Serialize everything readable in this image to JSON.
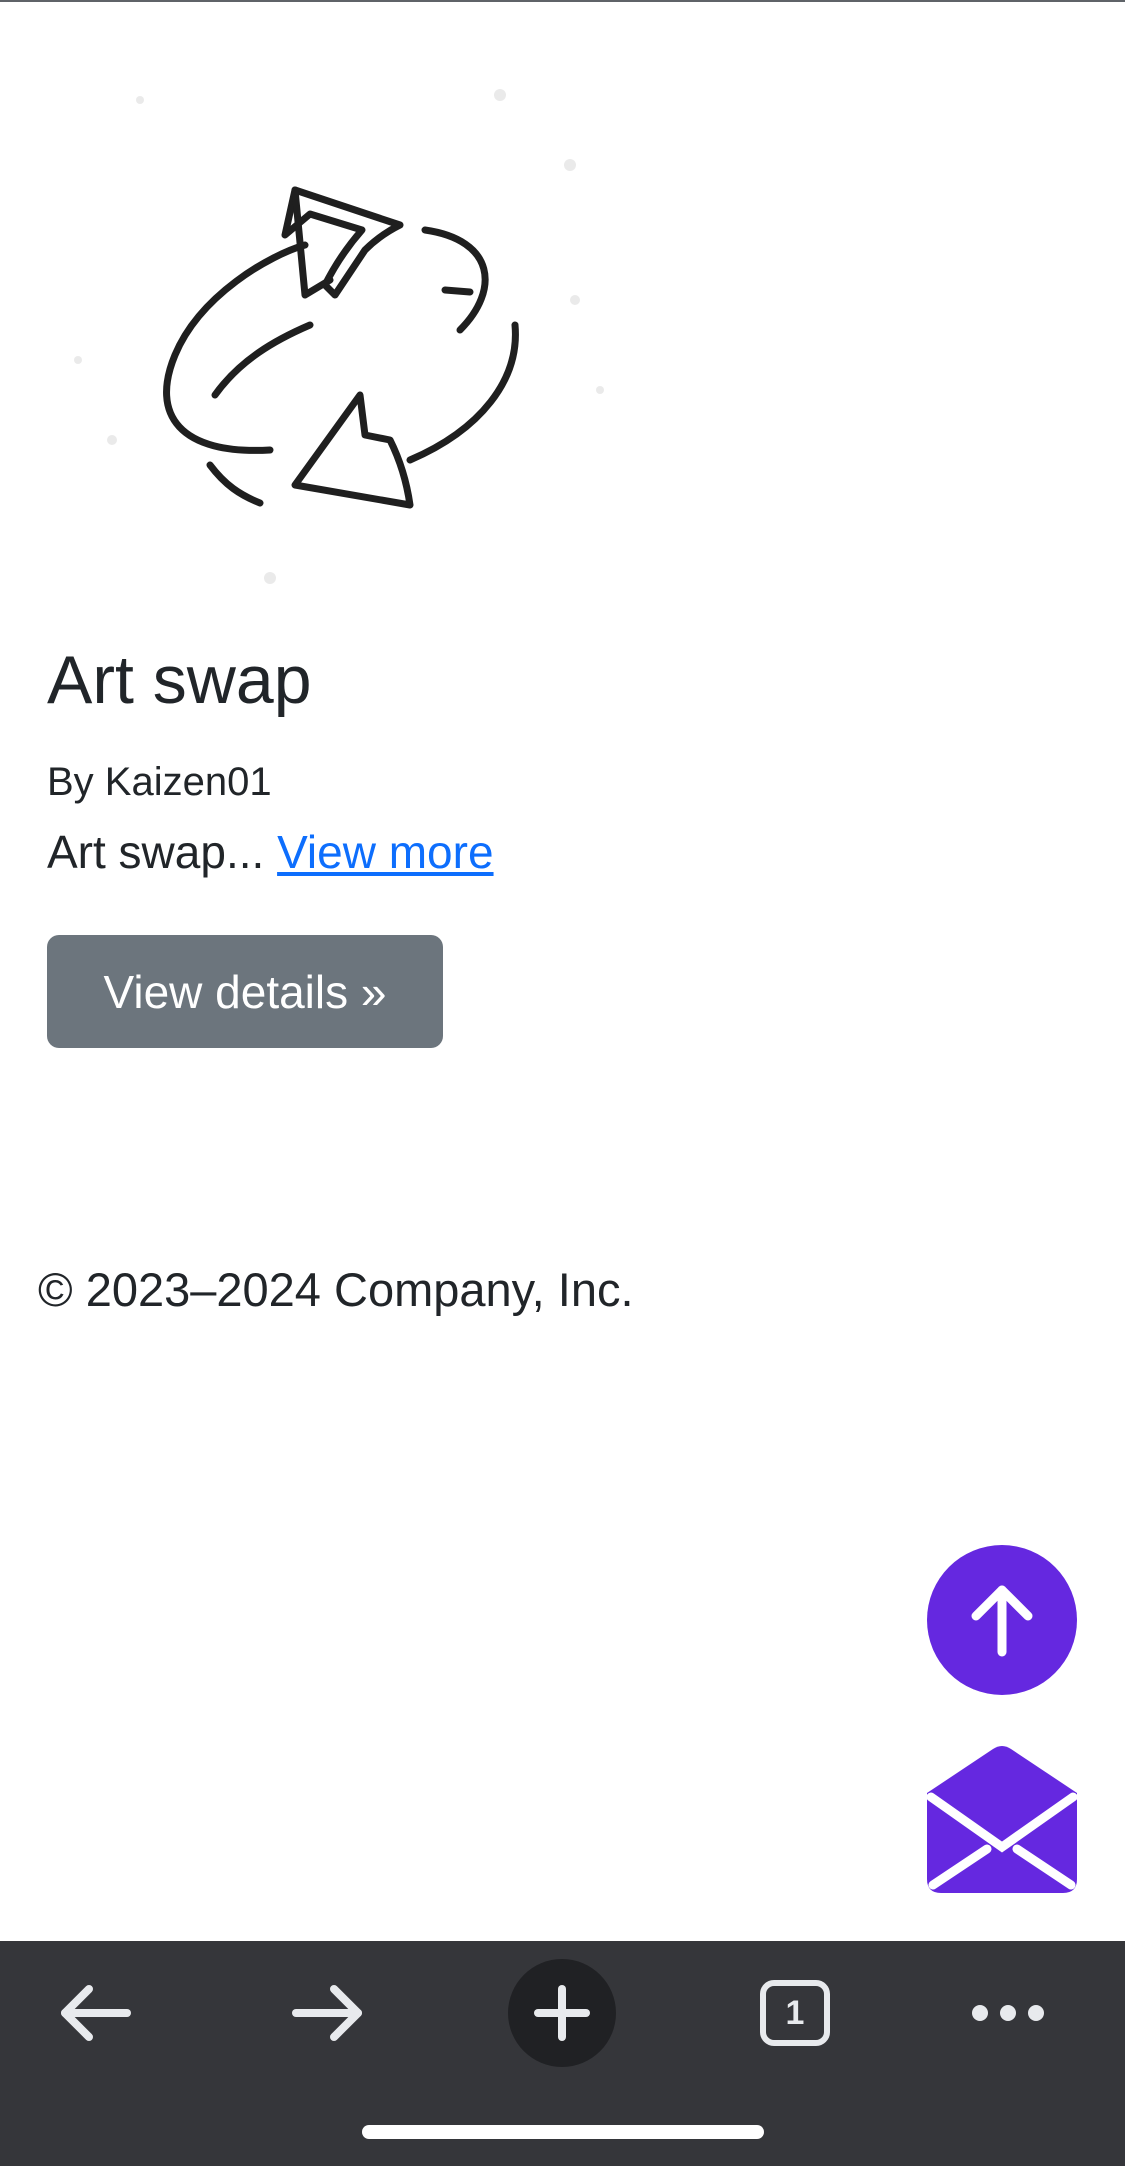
{
  "card": {
    "title": "Art swap",
    "author": "By Kaizen01",
    "description": "Art swap...",
    "view_more_label": "View more",
    "details_button_label": "View details »",
    "image_icon": "swap-arrows-icon"
  },
  "footer": {
    "copyright": "© 2023–2024 Company, Inc."
  },
  "floating_actions": {
    "scroll_top_icon": "arrow-up-icon",
    "mail_icon": "envelope-open-icon",
    "accent_color": "#6528e0"
  },
  "browser_toolbar": {
    "back_icon": "arrow-left-icon",
    "forward_icon": "arrow-right-icon",
    "new_tab_icon": "plus-icon",
    "tab_count": "1",
    "menu_icon": "more-horizontal-icon",
    "background_color": "#35363a"
  },
  "colors": {
    "link": "#0d6efd",
    "button_secondary": "#6c757d",
    "text": "#212529"
  }
}
